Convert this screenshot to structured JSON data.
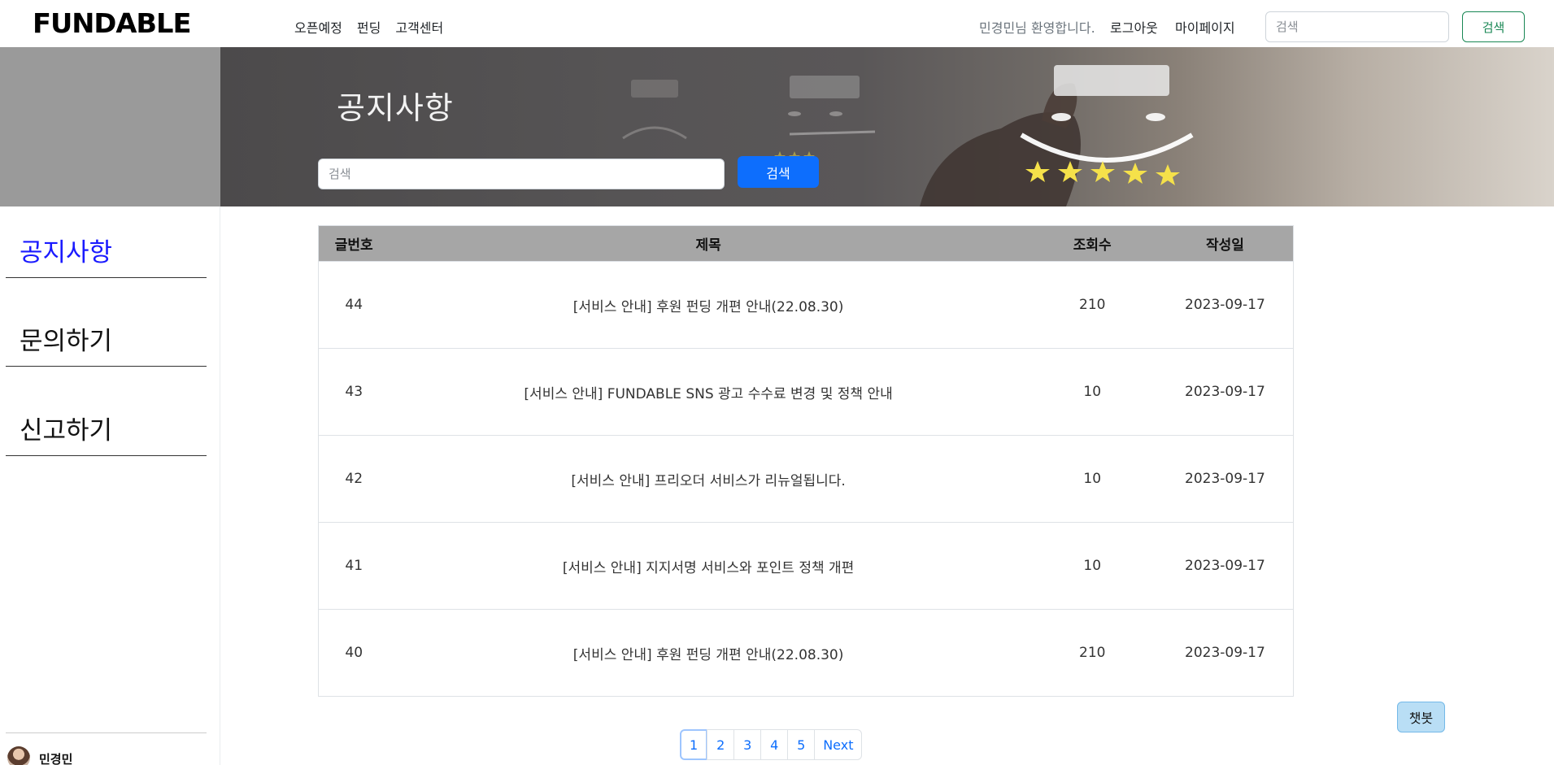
{
  "header": {
    "logo": "FUNDABLE",
    "nav": [
      "오픈예정",
      "펀딩",
      "고객센터"
    ],
    "greeting": "민경민님 환영합니다.",
    "logout": "로그아웃",
    "mypage": "마이페이지",
    "search_placeholder": "검색",
    "search_button": "검색"
  },
  "banner": {
    "title": "공지사항",
    "search_placeholder": "검색",
    "search_button": "검색"
  },
  "sidebar": {
    "items": [
      {
        "label": "공지사항",
        "active": true
      },
      {
        "label": "문의하기",
        "active": false
      },
      {
        "label": "신고하기",
        "active": false
      }
    ],
    "profile_name": "민경민"
  },
  "table": {
    "headers": [
      "글번호",
      "제목",
      "조회수",
      "작성일"
    ],
    "rows": [
      {
        "no": "44",
        "title": "[서비스 안내] 후원 펀딩 개편 안내(22.08.30)",
        "views": "210",
        "date": "2023-09-17"
      },
      {
        "no": "43",
        "title": "[서비스 안내] FUNDABLE SNS 광고 수수료 변경 및 정책 안내",
        "views": "10",
        "date": "2023-09-17"
      },
      {
        "no": "42",
        "title": "[서비스 안내] 프리오더 서비스가 리뉴얼됩니다.",
        "views": "10",
        "date": "2023-09-17"
      },
      {
        "no": "41",
        "title": "[서비스 안내] 지지서명 서비스와 포인트 정책 개편",
        "views": "10",
        "date": "2023-09-17"
      },
      {
        "no": "40",
        "title": "[서비스 안내] 후원 펀딩 개편 안내(22.08.30)",
        "views": "210",
        "date": "2023-09-17"
      }
    ]
  },
  "pagination": {
    "pages": [
      "1",
      "2",
      "3",
      "4",
      "5"
    ],
    "current": "1",
    "next": "Next"
  },
  "chatbot": {
    "label": "챗봇"
  },
  "colors": {
    "primary": "#0d6efd",
    "success": "#198754",
    "header_row": "#a6a6a6",
    "active_sidebar": "#1a1aff",
    "chatbot_bg": "#b9def5"
  }
}
